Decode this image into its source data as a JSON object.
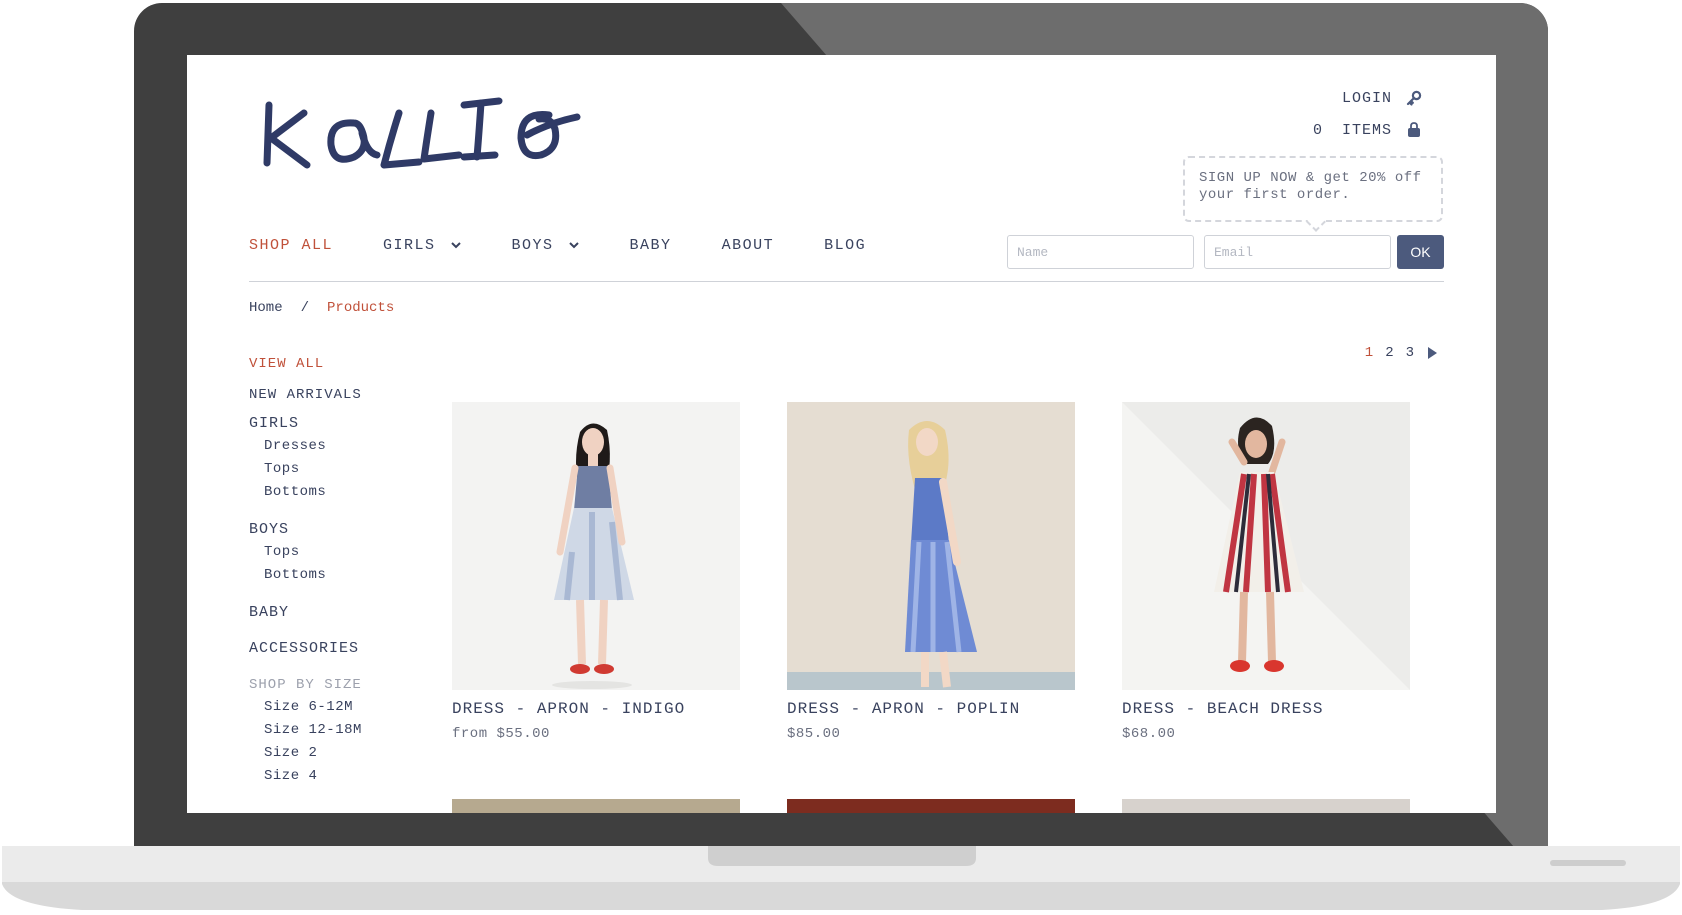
{
  "brand": {
    "logo_text": "KaLLI O"
  },
  "header": {
    "login_label": "LOGIN",
    "cart_count": "0",
    "cart_label": "ITEMS",
    "signup_message": "SIGN UP NOW & get 20% off your first order."
  },
  "nav": {
    "items": [
      {
        "label": "SHOP ALL",
        "active": true
      },
      {
        "label": "GIRLS",
        "dropdown": true
      },
      {
        "label": "BOYS",
        "dropdown": true
      },
      {
        "label": "BABY"
      },
      {
        "label": "ABOUT"
      },
      {
        "label": "BLOG"
      }
    ]
  },
  "newsletter": {
    "name_placeholder": "Name",
    "email_placeholder": "Email",
    "submit_label": "OK"
  },
  "breadcrumb": {
    "home": "Home",
    "separator": "/",
    "current": "Products"
  },
  "sidebar": {
    "view_all": "VIEW ALL",
    "new_arrivals": "NEW ARRIVALS",
    "girls": {
      "label": "GIRLS",
      "items": [
        "Dresses",
        "Tops",
        "Bottoms"
      ]
    },
    "boys": {
      "label": "BOYS",
      "items": [
        "Tops",
        "Bottoms"
      ]
    },
    "baby": "BABY",
    "accessories": "ACCESSORIES",
    "shop_by_size": {
      "label": "SHOP BY SIZE",
      "items": [
        "Size 6-12M",
        "Size 12-18M",
        "Size 2",
        "Size 4"
      ]
    }
  },
  "pagination": {
    "pages": [
      "1",
      "2",
      "3"
    ],
    "current": "1"
  },
  "products": [
    {
      "name": "DRESS - APRON - INDIGO",
      "price": "from $55.00"
    },
    {
      "name": "DRESS - APRON - POPLIN",
      "price": "$85.00"
    },
    {
      "name": "DRESS - BEACH DRESS",
      "price": "$68.00"
    }
  ],
  "colors": {
    "accent": "#c0513a",
    "text": "#39425e",
    "button": "#4c5a7d"
  }
}
